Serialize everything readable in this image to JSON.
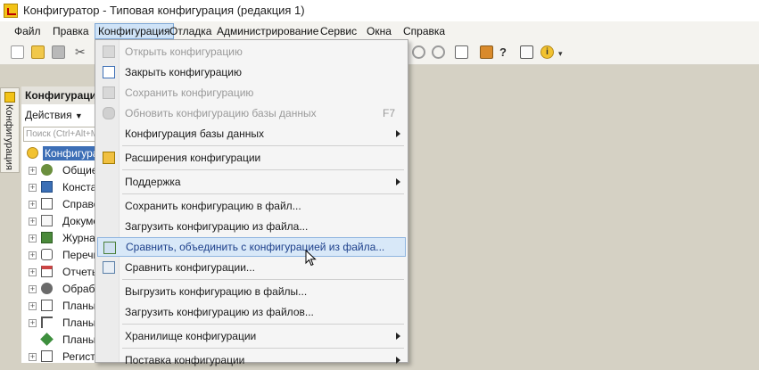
{
  "window": {
    "title": "Конфигуратор - Типовая конфигурация (редакция 1)"
  },
  "menubar": [
    {
      "label": "Файл",
      "active": false
    },
    {
      "label": "Правка",
      "active": false
    },
    {
      "label": "Конфигурация",
      "active": true
    },
    {
      "label": "Отладка",
      "active": false
    },
    {
      "label": "Администрирование",
      "active": false
    },
    {
      "label": "Сервис",
      "active": false
    },
    {
      "label": "Окна",
      "active": false
    },
    {
      "label": "Справка",
      "active": false
    }
  ],
  "side_tab": {
    "label": "Конфигурация"
  },
  "panel": {
    "header": "Конфигурация",
    "actions_label": "Действия",
    "search_placeholder": "Поиск (Ctrl+Alt+M)",
    "tree": [
      {
        "label": "Конфигурация",
        "selected": true,
        "icon": "config-root-icon"
      },
      {
        "label": "Общие",
        "icon": "common-icon"
      },
      {
        "label": "Константы",
        "icon": "constants-icon"
      },
      {
        "label": "Справочники",
        "icon": "catalogs-icon"
      },
      {
        "label": "Документы",
        "icon": "documents-icon"
      },
      {
        "label": "Журналы документов",
        "icon": "journals-icon"
      },
      {
        "label": "Перечисления",
        "icon": "enums-icon"
      },
      {
        "label": "Отчеты",
        "icon": "reports-icon"
      },
      {
        "label": "Обработки",
        "icon": "dataprocessors-icon"
      },
      {
        "label": "Планы видов характеристик",
        "icon": "chart-char-icon"
      },
      {
        "label": "Планы счетов",
        "icon": "chart-accounts-icon"
      },
      {
        "label": "Планы видов расчета",
        "icon": "chart-calc-icon"
      },
      {
        "label": "Регистры сведений",
        "icon": "registers-icon"
      }
    ]
  },
  "dropdown": {
    "items": [
      {
        "label": "Открыть конфигурацию",
        "disabled": true,
        "icon": "open-config-icon"
      },
      {
        "label": "Закрыть конфигурацию",
        "icon": "close-config-icon"
      },
      {
        "label": "Сохранить конфигурацию",
        "disabled": true,
        "icon": "save-config-icon"
      },
      {
        "label": "Обновить конфигурацию базы данных",
        "disabled": true,
        "shortcut": "F7",
        "icon": "update-db-icon"
      },
      {
        "label": "Конфигурация базы данных",
        "submenu": true
      },
      {
        "separator": true
      },
      {
        "label": "Расширения конфигурации",
        "icon": "extensions-icon"
      },
      {
        "separator": true
      },
      {
        "label": "Поддержка",
        "submenu": true
      },
      {
        "separator": true
      },
      {
        "label": "Сохранить конфигурацию в файл..."
      },
      {
        "label": "Загрузить конфигурацию из файла..."
      },
      {
        "label": "Сравнить, объединить с конфигурацией из файла...",
        "highlighted": true,
        "icon": "compare-merge-icon"
      },
      {
        "label": "Сравнить конфигурации...",
        "icon": "compare-icon"
      },
      {
        "separator": true
      },
      {
        "label": "Выгрузить конфигурацию в файлы..."
      },
      {
        "label": "Загрузить конфигурацию из файлов..."
      },
      {
        "separator": true
      },
      {
        "label": "Хранилище конфигурации",
        "submenu": true
      },
      {
        "separator": true
      },
      {
        "label": "Поставка конфигурации",
        "submenu": true
      }
    ]
  },
  "colors": {
    "accent": "#3d6fb6",
    "highlight": "#d8e8f8",
    "workspace": "#d5d1c4"
  }
}
